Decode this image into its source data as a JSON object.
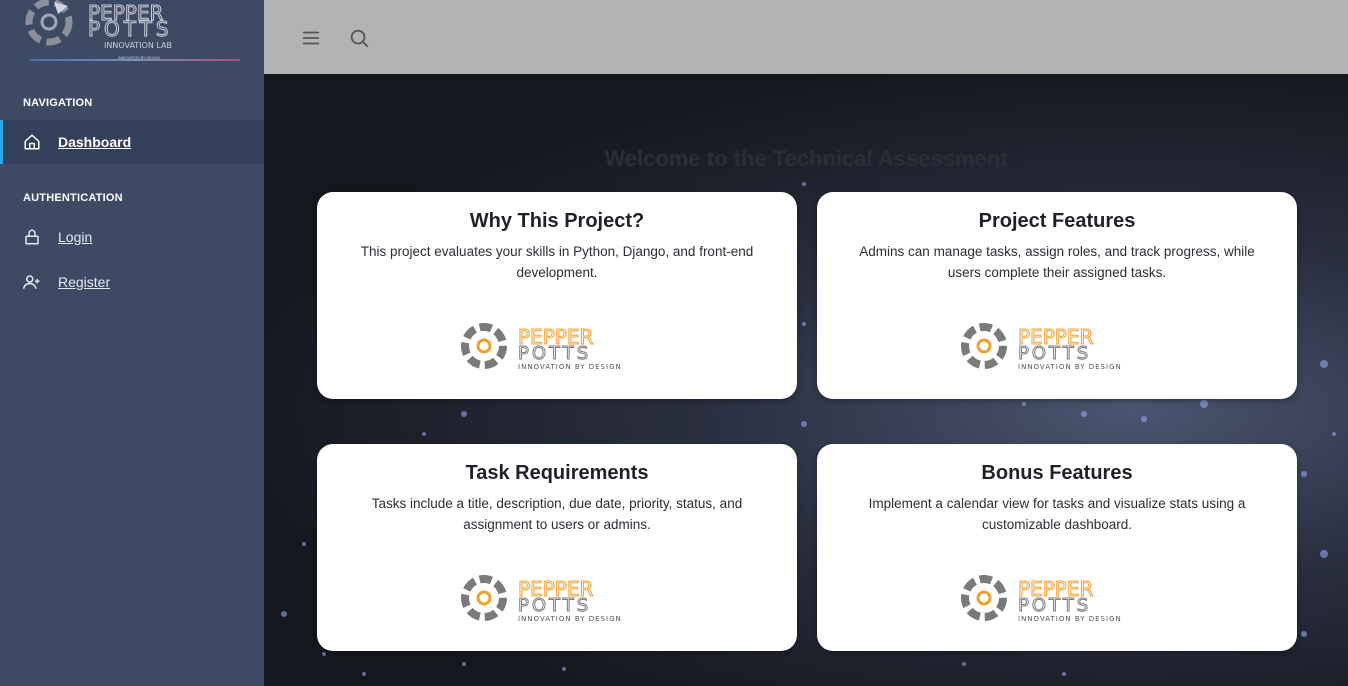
{
  "brand": {
    "line1": "PEPPER",
    "line2": "POTTS",
    "line3": "INNOVATION LAB",
    "tagline": "INNOVATION BY DESIGN"
  },
  "sidebar": {
    "sections": [
      {
        "heading": "NAVIGATION",
        "items": [
          {
            "label": "Dashboard",
            "icon": "home-icon",
            "active": true
          }
        ]
      },
      {
        "heading": "AUTHENTICATION",
        "items": [
          {
            "label": "Login",
            "icon": "lock-icon"
          },
          {
            "label": "Register",
            "icon": "user-plus-icon"
          }
        ]
      }
    ]
  },
  "topbar": {
    "icons": [
      "menu-icon",
      "search-icon"
    ]
  },
  "main": {
    "welcome": "Welcome to the Technical Assessment",
    "cards": [
      {
        "title": "Why This Project?",
        "text": "This project evaluates your skills in Python, Django, and front-end development."
      },
      {
        "title": "Project Features",
        "text": "Admins can manage tasks, assign roles, and track progress, while users complete their assigned tasks."
      },
      {
        "title": "Task Requirements",
        "text": "Tasks include a title, description, due date, priority, status, and assignment to users or admins."
      },
      {
        "title": "Bonus Features",
        "text": "Implement a calendar view for tasks and visualize stats using a customizable dashboard."
      }
    ],
    "card_logo": {
      "line1": "PEPPER",
      "line2": "POTTS",
      "tagline": "INNOVATION BY DESIGN"
    }
  },
  "colors": {
    "sidebar_bg": "#3d4a64",
    "active_accent": "#2fa4e7",
    "topbar_bg": "#b3b3b3",
    "logo_orange": "#f0a030",
    "logo_gray": "#7a7a7a"
  }
}
